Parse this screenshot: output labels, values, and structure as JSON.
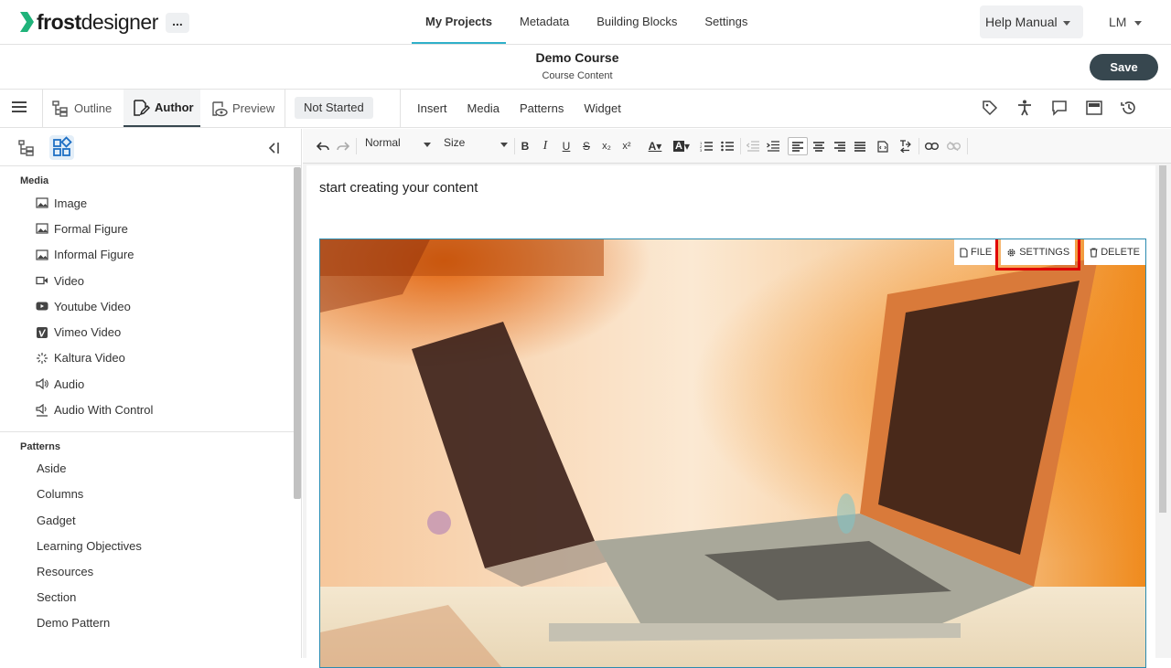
{
  "app": {
    "logo_bold": "frost",
    "logo_light": "designer",
    "more_label": "..."
  },
  "topnav": {
    "items": [
      {
        "label": "My Projects"
      },
      {
        "label": "Metadata"
      },
      {
        "label": "Building Blocks"
      },
      {
        "label": "Settings"
      }
    ],
    "active_index": 0
  },
  "header_right": {
    "help_label": "Help Manual",
    "user_initials": "LM"
  },
  "course": {
    "title": "Demo Course",
    "subtitle": "Course Content",
    "save_label": "Save"
  },
  "modes": {
    "outline": "Outline",
    "author": "Author",
    "preview": "Preview",
    "status": "Not Started"
  },
  "insert_tabs": [
    "Insert",
    "Media",
    "Patterns",
    "Widget"
  ],
  "right_icons": [
    "tag-icon",
    "accessibility-icon",
    "comment-icon",
    "layout-icon",
    "history-icon"
  ],
  "sidebar": {
    "media_title": "Media",
    "media_items": [
      {
        "label": "Image",
        "icon": "image-icon"
      },
      {
        "label": "Formal Figure",
        "icon": "image-icon"
      },
      {
        "label": "Informal Figure",
        "icon": "image-icon"
      },
      {
        "label": "Video",
        "icon": "video-icon"
      },
      {
        "label": "Youtube Video",
        "icon": "youtube-icon"
      },
      {
        "label": "Vimeo Video",
        "icon": "vimeo-icon"
      },
      {
        "label": "Kaltura Video",
        "icon": "kaltura-icon"
      },
      {
        "label": "Audio",
        "icon": "audio-icon"
      },
      {
        "label": "Audio With Control",
        "icon": "audio-control-icon"
      }
    ],
    "patterns_title": "Patterns",
    "pattern_items": [
      "Aside",
      "Columns",
      "Gadget",
      "Learning Objectives",
      "Resources",
      "Section",
      "Demo Pattern"
    ]
  },
  "toolbar": {
    "format_value": "Normal",
    "size_value": "Size"
  },
  "editor": {
    "placeholder": "start creating your content",
    "image_actions": {
      "file": "FILE",
      "settings": "SETTINGS",
      "delete": "DELETE"
    }
  },
  "colors": {
    "accent": "#2fb0c9",
    "save_bg": "#37474f",
    "highlight": "#e00000",
    "logo_green": "#1fb37a"
  }
}
